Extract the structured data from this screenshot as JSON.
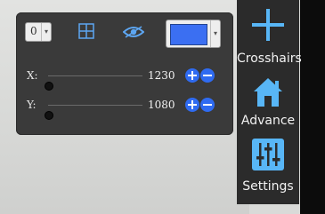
{
  "settings_panel": {
    "index_select": {
      "value": "0",
      "arrow": "▾"
    },
    "icons": {
      "grid": "grid-icon",
      "visibility": "eye-icon"
    },
    "color_select": {
      "color": "#3b6ff2",
      "arrow": "▾"
    },
    "x": {
      "label": "X:",
      "value": "1230",
      "slider_fraction": 0.0
    },
    "y": {
      "label": "Y:",
      "value": "1080",
      "slider_fraction": 0.0
    }
  },
  "toolbar": {
    "items": [
      {
        "label": "Crosshairs",
        "icon": "crosshairs-icon"
      },
      {
        "label": "Advance",
        "icon": "home-icon"
      },
      {
        "label": "Settings",
        "icon": "sliders-icon"
      }
    ]
  },
  "colors": {
    "accent": "#2f6bf1",
    "icon_blue": "#58b6f6",
    "panel": "#3a3a3a"
  }
}
